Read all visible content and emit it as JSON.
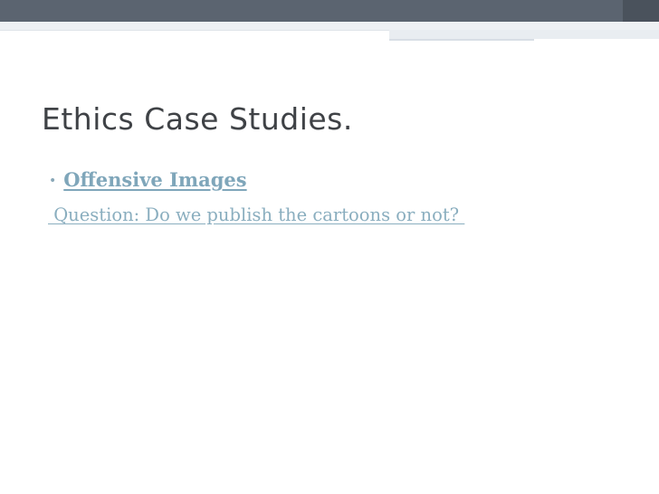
{
  "slide": {
    "title": "Ethics Case Studies.",
    "bullets": [
      {
        "marker": "•",
        "label": "Offensive Images"
      }
    ],
    "question_text": " Question: Do we publish the cartoons or not? "
  },
  "colors": {
    "top_band": "#5b6470",
    "title_text": "#3f4246",
    "link_text": "#7fa6ba",
    "background": "#ffffff"
  }
}
